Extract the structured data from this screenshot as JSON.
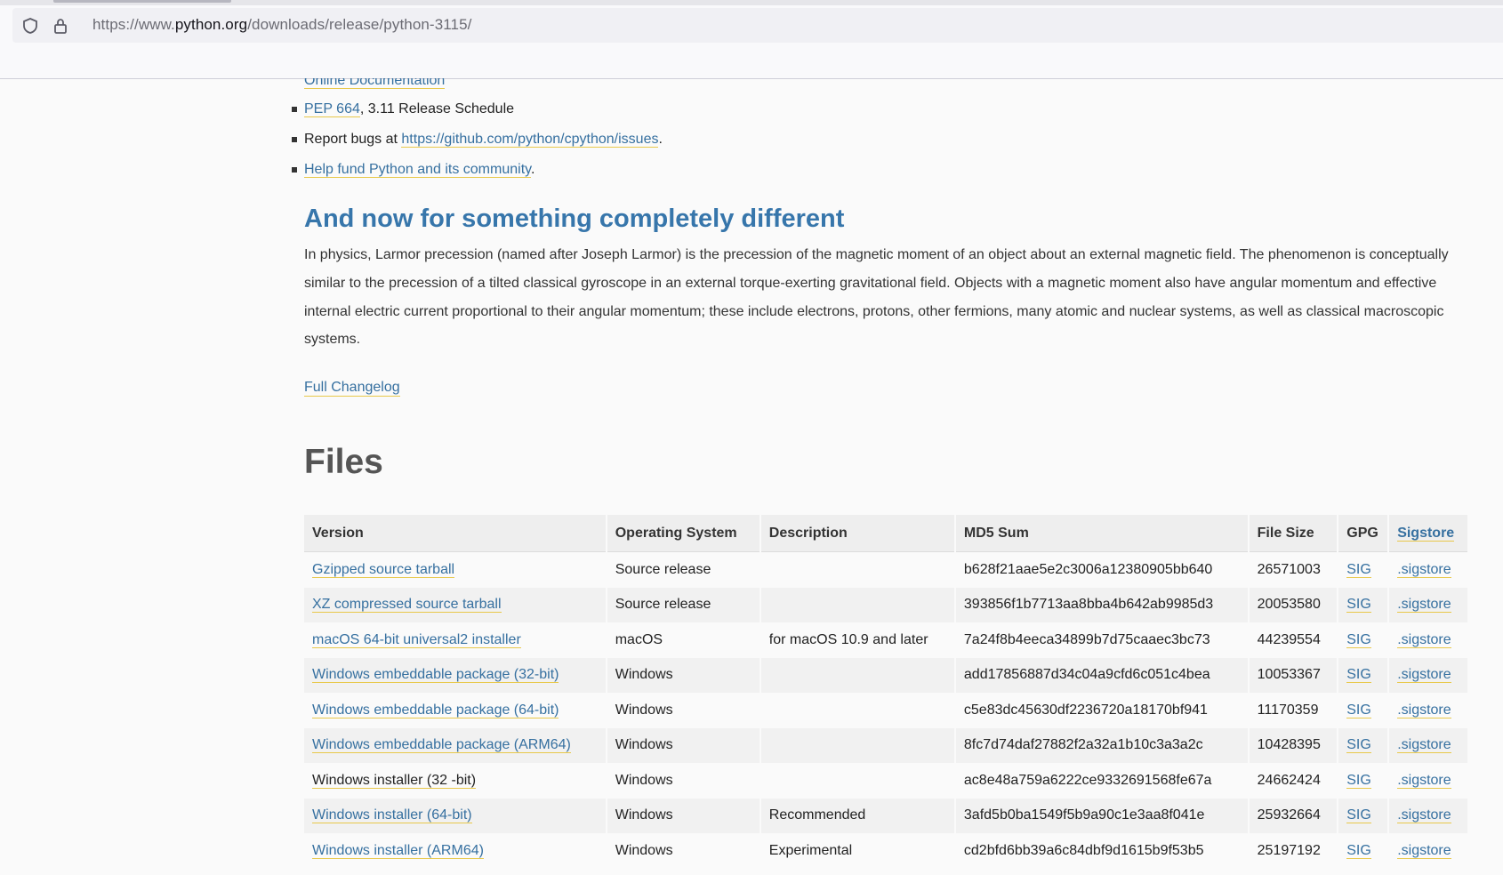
{
  "browser": {
    "url_prefix": "https://www.",
    "url_domain": "python.org",
    "url_path": "/downloads/release/python-3115/"
  },
  "bullets": {
    "cut_off_link": "Online Documentation",
    "pep_link": "PEP 664",
    "pep_text": ", 3.11 Release Schedule",
    "bugs_text": "Report bugs at ",
    "bugs_link": "https://github.com/python/cpython/issues",
    "bugs_period": ".",
    "fund_link": "Help fund Python and its community",
    "fund_period": "."
  },
  "section": {
    "title": "And now for something completely different",
    "paragraph": "In physics, Larmor precession (named after Joseph Larmor) is the precession of the magnetic moment of an object about an external magnetic field. The phenomenon is conceptually similar to the precession of a tilted classical gyroscope in an external torque-exerting gravitational field. Objects with a magnetic moment also have angular momentum and effective internal electric current proportional to their angular momentum; these include electrons, protons, other fermions, many atomic and nuclear systems, as well as classical macroscopic systems.",
    "changelog_link": "Full Changelog"
  },
  "files": {
    "title": "Files",
    "headers": [
      "Version",
      "Operating System",
      "Description",
      "MD5 Sum",
      "File Size",
      "GPG",
      "Sigstore"
    ],
    "rows": [
      {
        "version": "Gzipped source tarball",
        "os": "Source release",
        "desc": "",
        "md5": "b628f21aae5e2c3006a12380905bb640",
        "size": "26571003",
        "gpg": "SIG",
        "sigstore": ".sigstore"
      },
      {
        "version": "XZ compressed source tarball",
        "os": "Source release",
        "desc": "",
        "md5": "393856f1b7713aa8bba4b642ab9985d3",
        "size": "20053580",
        "gpg": "SIG",
        "sigstore": ".sigstore"
      },
      {
        "version": "macOS 64-bit universal2 installer",
        "os": "macOS",
        "desc": "for macOS 10.9 and later",
        "md5": "7a24f8b4eeca34899b7d75caaec3bc73",
        "size": "44239554",
        "gpg": "SIG",
        "sigstore": ".sigstore"
      },
      {
        "version": "Windows embeddable package (32-bit)",
        "os": "Windows",
        "desc": "",
        "md5": "add17856887d34c04a9cfd6c051c4bea",
        "size": "10053367",
        "gpg": "SIG",
        "sigstore": ".sigstore"
      },
      {
        "version": "Windows embeddable package (64-bit)",
        "os": "Windows",
        "desc": "",
        "md5": "c5e83dc45630df2236720a18170bf941",
        "size": "11170359",
        "gpg": "SIG",
        "sigstore": ".sigstore"
      },
      {
        "version": "Windows embeddable package (ARM64)",
        "os": "Windows",
        "desc": "",
        "md5": "8fc7d74daf27882f2a32a1b10c3a3a2c",
        "size": "10428395",
        "gpg": "SIG",
        "sigstore": ".sigstore"
      },
      {
        "version": "Windows installer (32 -bit)",
        "os": "Windows",
        "desc": "",
        "md5": "ac8e48a759a6222ce9332691568fe67a",
        "size": "24662424",
        "gpg": "SIG",
        "sigstore": ".sigstore"
      },
      {
        "version": "Windows installer (64-bit)",
        "os": "Windows",
        "desc": "Recommended",
        "md5": "3afd5b0ba1549f5b9a90c1e3aa8f041e",
        "size": "25932664",
        "gpg": "SIG",
        "sigstore": ".sigstore"
      },
      {
        "version": "Windows installer (ARM64)",
        "os": "Windows",
        "desc": "Experimental",
        "md5": "cd2bfd6bb39a6c84dbf9d1615b9f53b5",
        "size": "25197192",
        "gpg": "SIG",
        "sigstore": ".sigstore"
      }
    ]
  }
}
